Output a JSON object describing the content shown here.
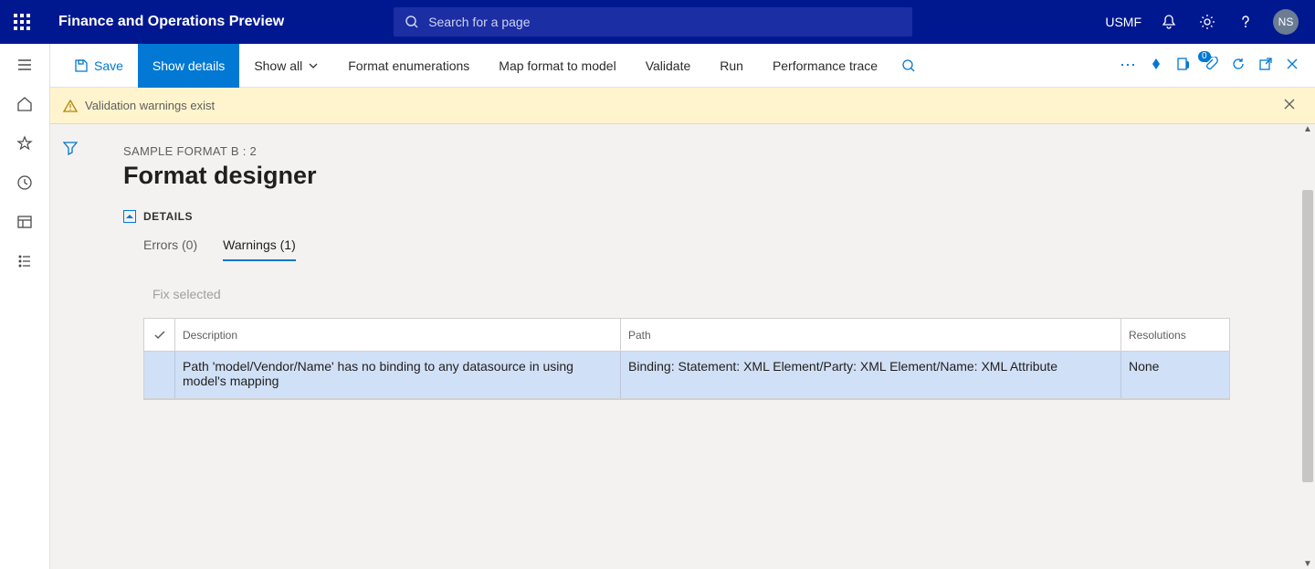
{
  "top": {
    "app_title": "Finance and Operations Preview",
    "search_placeholder": "Search for a page",
    "company": "USMF",
    "avatar": "NS"
  },
  "commands": {
    "save": "Save",
    "show_details": "Show details",
    "show_all": "Show all",
    "format_enum": "Format enumerations",
    "map_model": "Map format to model",
    "validate": "Validate",
    "run": "Run",
    "perf_trace": "Performance trace",
    "attach_badge": "0"
  },
  "notification": {
    "text": "Validation warnings exist"
  },
  "page": {
    "breadcrumb": "SAMPLE FORMAT B : 2",
    "title": "Format designer",
    "details_label": "DETAILS"
  },
  "tabs": {
    "errors": "Errors (0)",
    "warnings": "Warnings (1)"
  },
  "actions": {
    "fix_selected": "Fix selected"
  },
  "grid": {
    "headers": {
      "description": "Description",
      "path": "Path",
      "resolutions": "Resolutions"
    },
    "rows": [
      {
        "description": "Path 'model/Vendor/Name' has no binding to any datasource in using model's mapping",
        "path": "Binding: Statement: XML Element/Party: XML Element/Name: XML Attribute",
        "resolutions": "None"
      }
    ]
  }
}
